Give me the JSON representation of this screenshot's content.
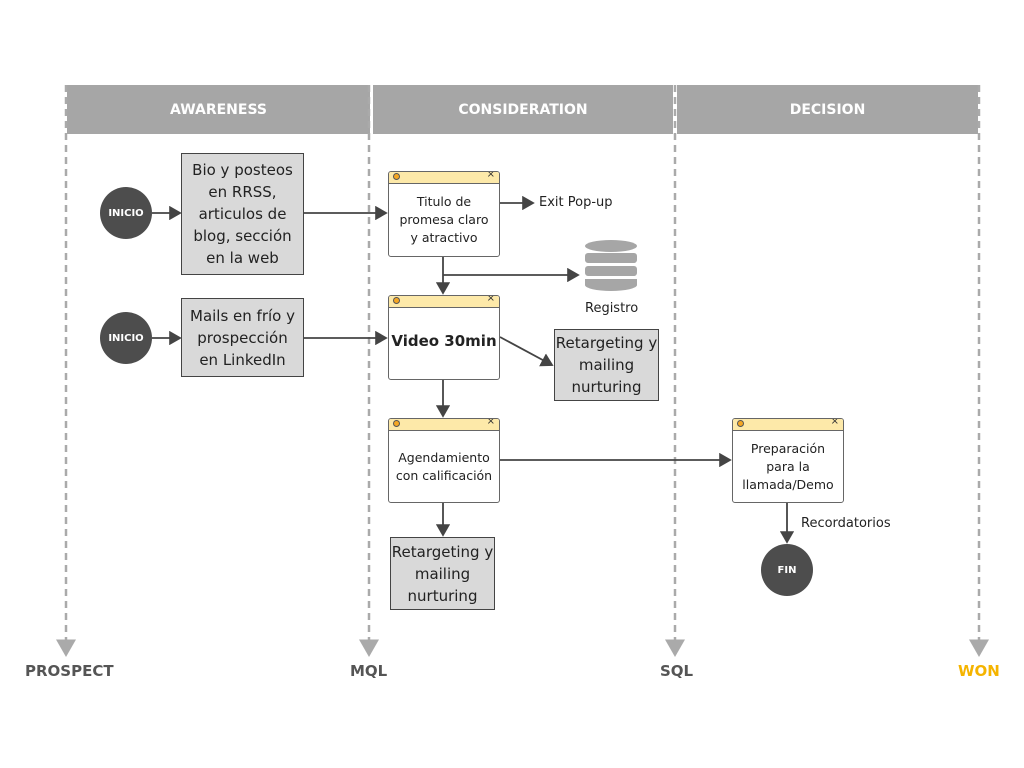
{
  "stages": {
    "awareness": "AWARENESS",
    "consideration": "CONSIDERATION",
    "decision": "DECISION"
  },
  "milestones": {
    "prospect": "PROSPECT",
    "mql": "MQL",
    "sql": "SQL",
    "won": "WON"
  },
  "colors": {
    "won": "#f5b400",
    "header": "#a6a6a6",
    "node": "#4d4d4d",
    "window_bar": "#fde9a9"
  },
  "nodes": {
    "inicio1": "INICIO",
    "inicio2": "INICIO",
    "fin": "FIN",
    "bio": "Bio y posteos en RRSS, articulos de blog, sección en la web",
    "mails": "Mails en frío y prospección en LinkedIn",
    "titulo": "Titulo de promesa claro y atractivo",
    "video": "Video 30min",
    "agendamiento": "Agendamiento con calificación",
    "retargeting1": "Retargeting y mailing nurturing",
    "retargeting2": "Retargeting y mailing nurturing",
    "preparacion": "Preparación para la llamada/Demo",
    "exit": "Exit Pop-up",
    "registro": "Registro",
    "recordatorios": "Recordatorios"
  }
}
